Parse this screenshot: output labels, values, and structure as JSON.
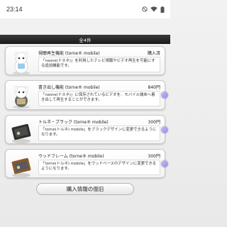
{
  "status_bar": {
    "time": "23:14",
    "icons": [
      "do-not-disturb-icon",
      "wifi-icon",
      "battery-icon"
    ]
  },
  "list": {
    "count_label": "全4件"
  },
  "items": [
    {
      "title": "視聴再生機能 (torne® mobile)",
      "status": "購入済",
      "description": "「nasne(ナスネ)」を利用したテレビ視聴やビデオ再生を可能にする追加機能です。",
      "thumb_icon": "character-thumbnail-icon"
    },
    {
      "title": "書き出し機能 (torne® mobile)",
      "status": "840円",
      "description": "「nasne(ナスネ)」に保存されているビデオを、モバイル端末へ書き出して再生することができます。",
      "thumb_icon": "dressed-character-thumbnail-icon"
    },
    {
      "title": "トルネ・ブラック (torne® mobile)",
      "status": "300円",
      "description": "「torne(トルネ) mobile」をブラックデザインに変更できるようになります。",
      "thumb_icon": "black-design-thumbnail-icon"
    },
    {
      "title": "ウッドフレーム (torne® mobile)",
      "status": "300円",
      "description": "「torne(トルネ) mobile」をウッドベースのデザインに変更できるようになります。",
      "thumb_icon": "wood-frame-thumbnail-icon"
    }
  ],
  "restore_button": {
    "label": "購入情報の復旧"
  },
  "colors": {
    "count_bar": "#232323",
    "card_bg": "#ffffff",
    "accent_arrow": "#a593ea"
  }
}
